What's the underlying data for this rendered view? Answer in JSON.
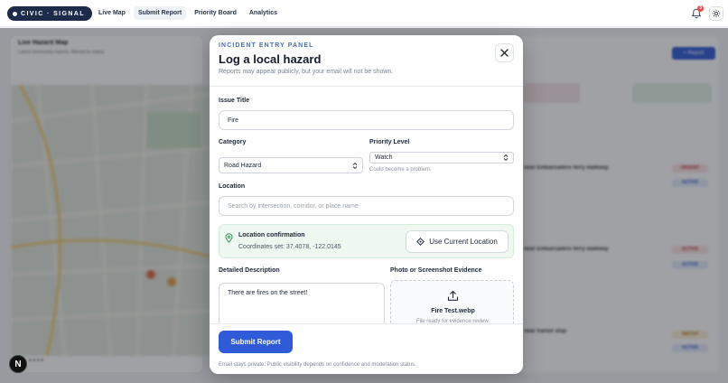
{
  "nav": {
    "brand": "CIVIC · SIGNAL",
    "items": [
      {
        "label": "Live Map",
        "active": false
      },
      {
        "label": "Submit Report",
        "active": true
      },
      {
        "label": "Priority Board",
        "active": false
      },
      {
        "label": "Analytics",
        "active": false
      }
    ],
    "notification_count": "3",
    "icons": {
      "bell": "bell-icon",
      "settings": "gear-icon"
    }
  },
  "background": {
    "map_title": "Live Hazard Map",
    "map_subtitle": "Latest community reports, filtered by status",
    "right_button": "+ Report",
    "rows": [
      "near Embarcadero ferry walkway",
      "near Embarcadero ferry walkway",
      "near transit stop"
    ],
    "pills": [
      "URGENT",
      "ACTIVE",
      "ACTIVE",
      "ACTIVE",
      "WATCH",
      "ACTIVE"
    ],
    "next_badge": "N"
  },
  "modal": {
    "eyebrow": "INCIDENT ENTRY PANEL",
    "title": "Log a local hazard",
    "subtitle": "Reports may appear publicly, but your email will not be shown.",
    "issue_title": {
      "label": "Issue Title",
      "value": "Fire"
    },
    "category": {
      "label": "Category",
      "value": "Road Hazard"
    },
    "priority": {
      "label": "Priority Level",
      "value": "Watch",
      "hint": "Could become a problem."
    },
    "location": {
      "label": "Location",
      "placeholder": "Search by intersection, corridor, or place name"
    },
    "confirmation": {
      "title": "Location confirmation",
      "coords": "Coordinates set: 37.4078, -122.0145",
      "button": "Use Current Location"
    },
    "description": {
      "label": "Detailed Description",
      "value": "There are fires on the street!"
    },
    "evidence": {
      "label": "Photo or Screenshot Evidence",
      "file_name": "Fire Test.webp",
      "status": "File ready for evidence review."
    },
    "submit": "Submit Report",
    "footer_note": "Email stays private. Public visibility depends on confidence and moderation status."
  },
  "colors": {
    "brand_navy": "#1d2b4a",
    "primary_blue": "#2f5bd9",
    "confirm_green_bg": "#eef8f1",
    "eyebrow_blue": "#4a6fb0"
  }
}
